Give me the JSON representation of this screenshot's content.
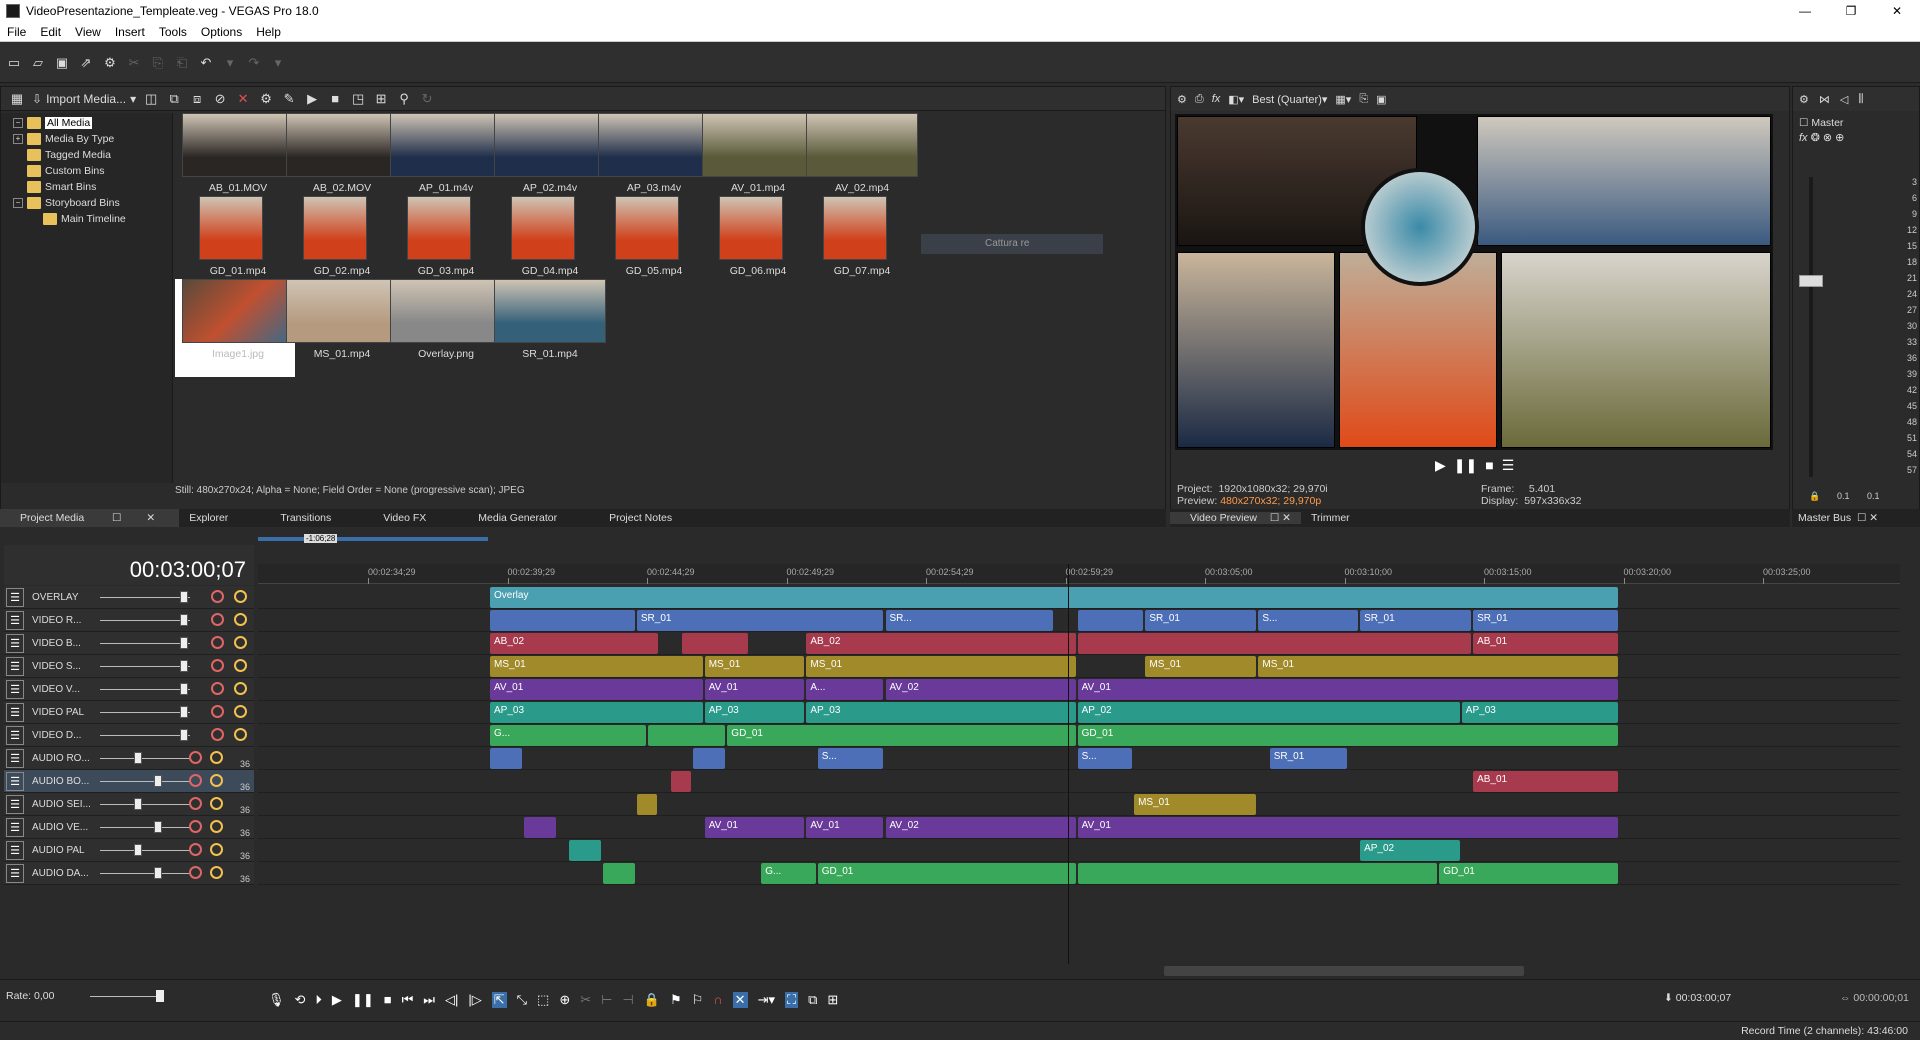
{
  "window": {
    "title": "VideoPresentazione_Templeate.veg - VEGAS Pro 18.0"
  },
  "menu": [
    "File",
    "Edit",
    "View",
    "Insert",
    "Tools",
    "Options",
    "Help"
  ],
  "project_media": {
    "import_label": "Import Media...",
    "tree": [
      {
        "label": "All Media",
        "selected": true,
        "expander": "-"
      },
      {
        "label": "Media By Type",
        "expander": "+"
      },
      {
        "label": "Tagged Media",
        "expander": ""
      },
      {
        "label": "Custom Bins",
        "expander": ""
      },
      {
        "label": "Smart Bins",
        "expander": ""
      },
      {
        "label": "Storyboard Bins",
        "expander": "-"
      },
      {
        "label": "Main Timeline",
        "expander": "",
        "indent": true
      }
    ],
    "items": [
      {
        "name": "AB_01.MOV",
        "color": "#2a2623"
      },
      {
        "name": "AB_02.MOV",
        "color": "#2a2623"
      },
      {
        "name": "AP_01.m4v",
        "color": "#1f2e4a"
      },
      {
        "name": "AP_02.m4v",
        "color": "#1f2e4a"
      },
      {
        "name": "AP_03.m4v",
        "color": "#1f2e4a"
      },
      {
        "name": "AV_01.mp4",
        "color": "#5a5a3a"
      },
      {
        "name": "AV_02.mp4",
        "color": "#5a5a3a"
      },
      {
        "name": "GD_01.mp4",
        "color": "#d0401a"
      },
      {
        "name": "GD_02.mp4",
        "color": "#d0401a"
      },
      {
        "name": "GD_03.mp4",
        "color": "#d0401a"
      },
      {
        "name": "GD_04.mp4",
        "color": "#d0401a"
      },
      {
        "name": "GD_05.mp4",
        "color": "#d0401a"
      },
      {
        "name": "GD_06.mp4",
        "color": "#d0401a"
      },
      {
        "name": "GD_07.mp4",
        "color": "#d0401a"
      },
      {
        "name": "Image1.jpg",
        "color": "#444",
        "selected": true
      },
      {
        "name": "MS_01.mp4",
        "color": "#b59a80"
      },
      {
        "name": "Overlay.png",
        "color": "#888"
      },
      {
        "name": "SR_01.mp4",
        "color": "#34607a"
      }
    ],
    "hover_tip": "Cattura re",
    "status": "Still: 480x270x24; Alpha = None; Field Order = None (progressive scan); JPEG"
  },
  "bottom_tabs": [
    "Project Media",
    "Explorer",
    "Transitions",
    "Video FX",
    "Media Generator",
    "Project Notes"
  ],
  "preview": {
    "quality": "Best (Quarter)",
    "project_label": "Project:",
    "project_value": "1920x1080x32; 29,970i",
    "preview_label": "Preview:",
    "preview_value": "480x270x32; 29,970p",
    "frame_label": "Frame:",
    "frame_value": "5.401",
    "display_label": "Display:",
    "display_value": "597x336x32",
    "tabs": [
      "Video Preview",
      "Trimmer"
    ]
  },
  "master_bus": {
    "label": "Master",
    "scale": [
      "3",
      "6",
      "9",
      "12",
      "15",
      "18",
      "21",
      "24",
      "27",
      "30",
      "33",
      "36",
      "39",
      "42",
      "45",
      "48",
      "51",
      "54",
      "57"
    ],
    "bottom_values": [
      "0.1",
      "0.1"
    ],
    "tab": "Master Bus"
  },
  "timeline": {
    "timecode": "00:03:00;07",
    "marker": "-1:06;28",
    "ruler": [
      "00:02:34;29",
      "00:02:39;29",
      "00:02:44;29",
      "00:02:49;29",
      "00:02:54;29",
      "00:02:59;29",
      "00:03:05;00",
      "00:03:10;00",
      "00:03:15;00",
      "00:03:20;00",
      "00:03:25;00"
    ],
    "tracks": [
      {
        "name": "OVERLAY",
        "type": "video",
        "color": "#4a9fb0"
      },
      {
        "name": "VIDEO R...",
        "type": "video",
        "color": "#4d6fb8"
      },
      {
        "name": "VIDEO B...",
        "type": "video",
        "color": "#a83a4e"
      },
      {
        "name": "VIDEO S...",
        "type": "video",
        "color": "#a08a2a"
      },
      {
        "name": "VIDEO V...",
        "type": "video",
        "color": "#6a3a9a"
      },
      {
        "name": "VIDEO PAL",
        "type": "video",
        "color": "#2a9a8a"
      },
      {
        "name": "VIDEO D...",
        "type": "video",
        "color": "#3aa85a"
      },
      {
        "name": "AUDIO RO...",
        "type": "audio",
        "num": "36",
        "color": "#4d6fb8"
      },
      {
        "name": "AUDIO BO...",
        "type": "audio",
        "num": "36",
        "color": "#a83a4e"
      },
      {
        "name": "AUDIO SEI...",
        "type": "audio",
        "num": "36",
        "color": "#a08a2a"
      },
      {
        "name": "AUDIO VE...",
        "type": "audio",
        "num": "36",
        "color": "#6a3a9a"
      },
      {
        "name": "AUDIO PAL",
        "type": "audio",
        "num": "36",
        "color": "#2a9a8a"
      },
      {
        "name": "AUDIO DA...",
        "type": "audio",
        "num": "36",
        "color": "#3aa85a"
      }
    ],
    "clips": [
      [
        {
          "label": "Overlay",
          "start": 0,
          "end": 1
        }
      ],
      [
        {
          "label": "",
          "start": 0,
          "end": 0.13
        },
        {
          "label": "SR_01",
          "start": 0.13,
          "end": 0.35
        },
        {
          "label": "SR...",
          "start": 0.35,
          "end": 0.5
        },
        {
          "label": "",
          "start": 0.52,
          "end": 0.58
        },
        {
          "label": "SR_01",
          "start": 0.58,
          "end": 0.68
        },
        {
          "label": "S...",
          "start": 0.68,
          "end": 0.77
        },
        {
          "label": "SR_01",
          "start": 0.77,
          "end": 0.87
        },
        {
          "label": "SR_01",
          "start": 0.87,
          "end": 1
        }
      ],
      [
        {
          "label": "AB_02",
          "start": 0,
          "end": 0.15
        },
        {
          "label": "",
          "start": 0.17,
          "end": 0.23
        },
        {
          "label": "AB_02",
          "start": 0.28,
          "end": 0.52
        },
        {
          "label": "",
          "start": 0.52,
          "end": 0.87
        },
        {
          "label": "AB_01",
          "start": 0.87,
          "end": 1
        }
      ],
      [
        {
          "label": "MS_01",
          "start": 0,
          "end": 0.19
        },
        {
          "label": "MS_01",
          "start": 0.19,
          "end": 0.28
        },
        {
          "label": "MS_01",
          "start": 0.28,
          "end": 0.52
        },
        {
          "label": "MS_01",
          "start": 0.58,
          "end": 0.68
        },
        {
          "label": "MS_01",
          "start": 0.68,
          "end": 1
        }
      ],
      [
        {
          "label": "AV_01",
          "start": 0,
          "end": 0.19
        },
        {
          "label": "AV_01",
          "start": 0.19,
          "end": 0.28
        },
        {
          "label": "A...",
          "start": 0.28,
          "end": 0.35
        },
        {
          "label": "AV_02",
          "start": 0.35,
          "end": 0.52
        },
        {
          "label": "AV_01",
          "start": 0.52,
          "end": 1
        }
      ],
      [
        {
          "label": "AP_03",
          "start": 0,
          "end": 0.19
        },
        {
          "label": "AP_03",
          "start": 0.19,
          "end": 0.28
        },
        {
          "label": "AP_03",
          "start": 0.28,
          "end": 0.52
        },
        {
          "label": "AP_02",
          "start": 0.52,
          "end": 0.86
        },
        {
          "label": "AP_03",
          "start": 0.86,
          "end": 1
        }
      ],
      [
        {
          "label": "G...",
          "start": 0,
          "end": 0.14
        },
        {
          "label": "",
          "start": 0.14,
          "end": 0.21
        },
        {
          "label": "GD_01",
          "start": 0.21,
          "end": 0.52
        },
        {
          "label": "GD_01",
          "start": 0.52,
          "end": 1
        }
      ],
      [
        {
          "label": "",
          "start": 0,
          "end": 0.03
        },
        {
          "label": "",
          "start": 0.18,
          "end": 0.21
        },
        {
          "label": "S...",
          "start": 0.29,
          "end": 0.35
        },
        {
          "label": "S...",
          "start": 0.52,
          "end": 0.57
        },
        {
          "label": "SR_01",
          "start": 0.69,
          "end": 0.76
        }
      ],
      [
        {
          "label": "",
          "start": 0.16,
          "end": 0.18
        },
        {
          "label": "AB_01",
          "start": 0.87,
          "end": 1
        }
      ],
      [
        {
          "label": "",
          "start": 0.13,
          "end": 0.15
        },
        {
          "label": "MS_01",
          "start": 0.57,
          "end": 0.68
        }
      ],
      [
        {
          "label": "",
          "start": 0.03,
          "end": 0.06
        },
        {
          "label": "AV_01",
          "start": 0.19,
          "end": 0.28
        },
        {
          "label": "AV_01",
          "start": 0.28,
          "end": 0.35
        },
        {
          "label": "AV_02",
          "start": 0.35,
          "end": 0.52
        },
        {
          "label": "AV_01",
          "start": 0.52,
          "end": 1
        }
      ],
      [
        {
          "label": "",
          "start": 0.07,
          "end": 0.1
        },
        {
          "label": "AP_02",
          "start": 0.77,
          "end": 0.86
        }
      ],
      [
        {
          "label": "",
          "start": 0.1,
          "end": 0.13
        },
        {
          "label": "G...",
          "start": 0.24,
          "end": 0.29
        },
        {
          "label": "GD_01",
          "start": 0.29,
          "end": 0.52
        },
        {
          "label": "",
          "start": 0.52,
          "end": 0.84
        },
        {
          "label": "GD_01",
          "start": 0.84,
          "end": 1
        }
      ]
    ]
  },
  "transport": {
    "rate": "Rate: 0,00",
    "cursor_time": "00:03:00;07",
    "selection_length": "00:00:00;01"
  },
  "status_bar": {
    "record_time": "Record Time (2 channels): 43:46:00"
  }
}
